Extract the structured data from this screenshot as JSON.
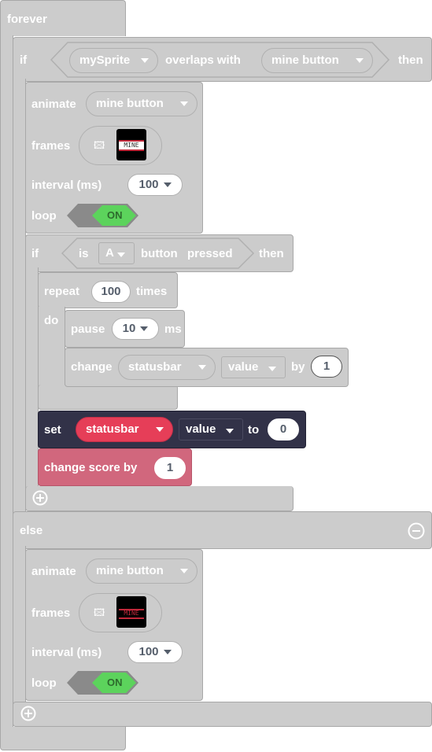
{
  "forever": {
    "label": "forever"
  },
  "if1": {
    "if_label": "if",
    "sprite": "mySprite",
    "overlaps": "overlaps with",
    "kind": "mine button",
    "then_label": "then",
    "else_label": "else"
  },
  "animate1": {
    "label": "animate",
    "sprite": "mine button",
    "frames_label": "frames",
    "frames_glyph": "🖾",
    "thumb_text": "MINE",
    "interval_label": "interval (ms)",
    "interval_value": "100",
    "loop_label": "loop",
    "loop_value": "ON"
  },
  "if2": {
    "if_label": "if",
    "is_label": "is",
    "button_name": "A",
    "button_label": "button",
    "pressed": "pressed",
    "then_label": "then"
  },
  "repeat": {
    "label": "repeat",
    "count": "100",
    "times_label": "times",
    "do_label": "do"
  },
  "pause": {
    "label": "pause",
    "value": "10",
    "unit": "ms"
  },
  "change": {
    "label": "change",
    "sprite": "statusbar",
    "field": "value",
    "by_label": "by",
    "amount": "1"
  },
  "set": {
    "label": "set",
    "sprite": "statusbar",
    "field": "value",
    "to_label": "to",
    "value": "0"
  },
  "score": {
    "label": "change score by",
    "amount": "1"
  },
  "animate2": {
    "label": "animate",
    "sprite": "mine button",
    "frames_label": "frames",
    "frames_glyph": "🖾",
    "thumb_text": "MINE",
    "interval_label": "interval (ms)",
    "interval_value": "100",
    "loop_label": "loop",
    "loop_value": "ON"
  },
  "colors": {
    "block_gray": "#cccccc",
    "set_dark": "#323248",
    "sprite_red": "#e63e58",
    "score_pink": "#d1677d",
    "toggle_green": "#5cd35c"
  }
}
